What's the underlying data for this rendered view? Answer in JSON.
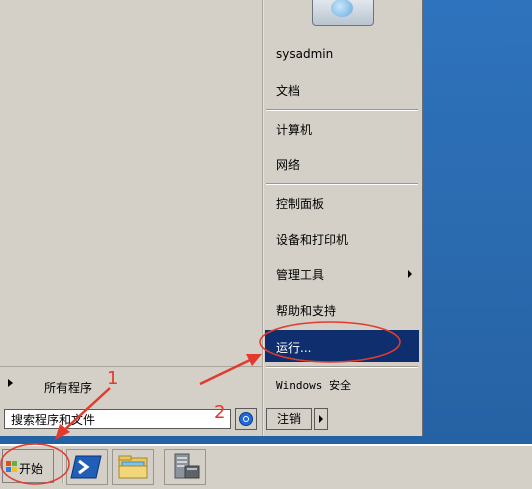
{
  "start_menu": {
    "user": {
      "name": "sysadmin"
    },
    "right_items": [
      {
        "label": "文档"
      },
      {
        "label": "计算机"
      },
      {
        "label": "网络"
      },
      {
        "label": "控制面板"
      },
      {
        "label": "设备和打印机"
      },
      {
        "label": "管理工具",
        "has_submenu": true
      },
      {
        "label": "帮助和支持"
      },
      {
        "label": "运行...",
        "highlighted": true
      },
      {
        "label": "Windows 安全"
      }
    ],
    "all_programs": "所有程序",
    "search": {
      "value": "搜索程序和文件",
      "placeholder": "搜索程序和文件"
    },
    "logoff": "注销"
  },
  "taskbar": {
    "start_label": "开始",
    "pinned": [
      {
        "icon": "powershell-icon"
      },
      {
        "icon": "explorer-folder-icon"
      },
      {
        "icon": "server-manager-icon"
      }
    ]
  },
  "annotations": {
    "label_1": "1",
    "label_2": "2",
    "color": "#e23b2d"
  },
  "colors": {
    "desktop": "#2a69ad",
    "menu_bg": "#d4d0c8",
    "highlight": "#0f2e6e"
  }
}
